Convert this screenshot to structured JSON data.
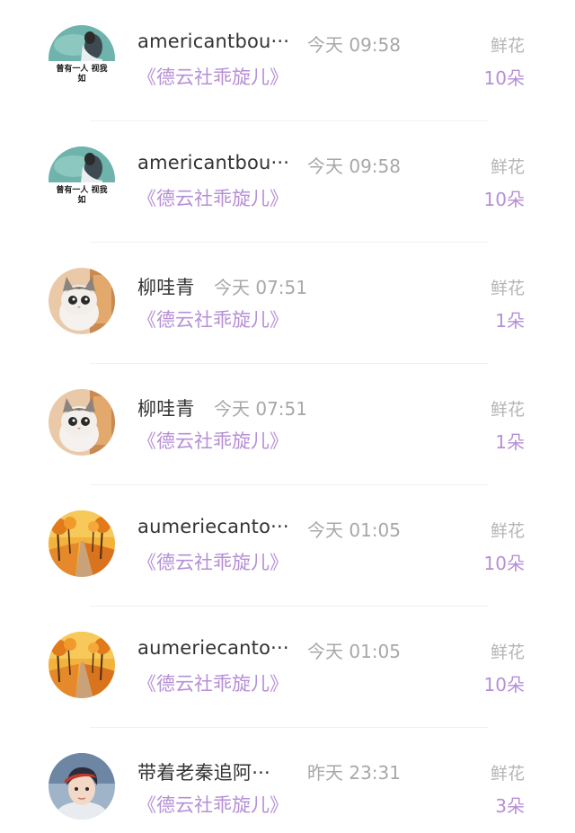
{
  "colors": {
    "accent": "#b68fd6",
    "name": "#333333",
    "muted": "#a8a8a8",
    "divider": "#f1f1f1"
  },
  "rows": [
    {
      "avatar": "ink-painting-avatar",
      "avatar_text": "曾有一人 视我如",
      "name": "americantbou···",
      "time": "今天 09:58",
      "desc": "《德云社乖旋儿》",
      "gift_type": "鲜花",
      "gift_count": "10朵"
    },
    {
      "avatar": "ink-painting-avatar",
      "avatar_text": "曾有一人 视我如",
      "name": "americantbou···",
      "time": "今天 09:58",
      "desc": "《德云社乖旋儿》",
      "gift_type": "鲜花",
      "gift_count": "10朵"
    },
    {
      "avatar": "cat-avatar",
      "name": "柳哇青",
      "time": "今天 07:51",
      "desc": "《德云社乖旋儿》",
      "gift_type": "鲜花",
      "gift_count": "1朵"
    },
    {
      "avatar": "cat-avatar",
      "name": "柳哇青",
      "time": "今天 07:51",
      "desc": "《德云社乖旋儿》",
      "gift_type": "鲜花",
      "gift_count": "1朵"
    },
    {
      "avatar": "autumn-road-avatar",
      "name": "aumeriecanto···",
      "time": "今天 01:05",
      "desc": "《德云社乖旋儿》",
      "gift_type": "鲜花",
      "gift_count": "10朵"
    },
    {
      "avatar": "autumn-road-avatar",
      "name": "aumeriecanto···",
      "time": "今天 01:05",
      "desc": "《德云社乖旋儿》",
      "gift_type": "鲜花",
      "gift_count": "10朵"
    },
    {
      "avatar": "person-avatar",
      "name": "带着老秦追阿···",
      "time": "昨天 23:31",
      "desc": "《德云社乖旋儿》",
      "gift_type": "鲜花",
      "gift_count": "3朵"
    }
  ]
}
